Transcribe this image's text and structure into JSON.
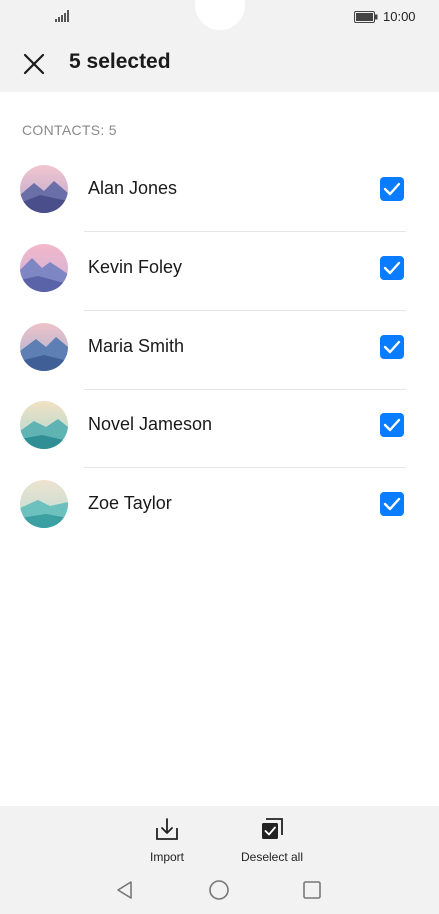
{
  "status_bar": {
    "time": "10:00"
  },
  "app_bar": {
    "title": "5 selected",
    "close_icon": "close-icon"
  },
  "section": {
    "header": "CONTACTS: 5"
  },
  "contacts": [
    {
      "name": "Alan Jones",
      "checked": true
    },
    {
      "name": "Kevin Foley",
      "checked": true
    },
    {
      "name": "Maria Smith",
      "checked": true
    },
    {
      "name": "Novel Jameson",
      "checked": true
    },
    {
      "name": "Zoe Taylor",
      "checked": true
    }
  ],
  "actions": {
    "import_label": "Import",
    "deselect_all_label": "Deselect all"
  },
  "colors": {
    "accent": "#0a7cff",
    "bar_background": "#f2f2f2",
    "list_background": "#ffffff",
    "section_header_text": "#8a8a8a"
  },
  "icons": [
    "signal-icon",
    "battery-icon",
    "close-icon",
    "checkbox-checked-icon",
    "import-icon",
    "deselect-all-icon",
    "back-nav-icon",
    "home-nav-icon",
    "recent-apps-icon"
  ]
}
